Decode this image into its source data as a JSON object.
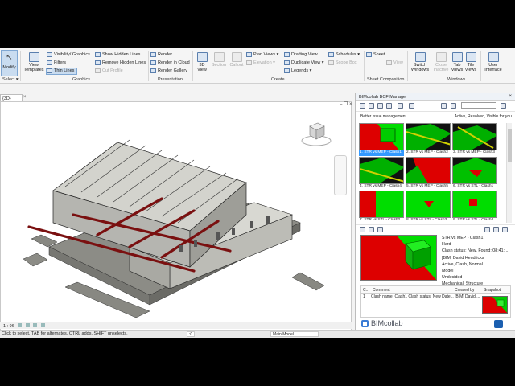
{
  "ribbon": {
    "modify": "Modify",
    "select": "Select ▾",
    "view_templates": "View Templates",
    "visibility": "Visibility/ Graphics",
    "filters": "Filters",
    "thin_lines": "Thin Lines",
    "show_hidden": "Show  Hidden Lines",
    "remove_hidden": "Remove  Hidden Lines",
    "cut_profile": "Cut  Profile",
    "render": "Render",
    "render_cloud": "Render  in Cloud",
    "render_gallery": "Render  Gallery",
    "view3d": "3D View",
    "section": "Section",
    "callout": "Callout",
    "plan_views": "Plan  Views ▾",
    "elevation": "Elevation ▾",
    "drafting_view": "Drafting  View",
    "duplicate_view": "Duplicate  View ▾",
    "legends": "Legends ▾",
    "schedules": "Schedules ▾",
    "scope_box": "Scope  Box",
    "sheet": "Sheet",
    "view_btn": "View",
    "switch_windows": "Switch Windows",
    "close_inactive": "Close Inactive",
    "tab_views": "Tab Views",
    "tile_views": "Tile Views",
    "user_interface": "User Interface",
    "groups": {
      "select": "Select",
      "graphics": "Graphics",
      "presentation": "Presentation",
      "create": "Create",
      "sheet_composition": "Sheet Composition",
      "windows": "Windows"
    }
  },
  "view": {
    "tab": "{3D}",
    "close": "×",
    "controls": "–  ❐  ×",
    "scale": "1 : 96"
  },
  "status": {
    "message": "Click to select, TAB for alternates, CTRL adds, SHIFT unselects.",
    "zero": ":0",
    "model": "Main Model"
  },
  "bcf": {
    "title": "BIMcollab BCF Manager",
    "close": "×",
    "subtitle": "Better issue management",
    "filter": "Active, Resolved, Visible for you",
    "issues": [
      {
        "label": "1. STR vs MEP - Clash1",
        "selected": true
      },
      {
        "label": "2. STR vs MEP - Clash2",
        "selected": false
      },
      {
        "label": "3. STR vs MEP - Clash3",
        "selected": false
      },
      {
        "label": "4. STR vs MEP - Clash4",
        "selected": false
      },
      {
        "label": "5. STR vs MEP - Clash5",
        "selected": false
      },
      {
        "label": "6. STR vs STL - Clash1",
        "selected": false
      },
      {
        "label": "7. STR vs STL - Clash2",
        "selected": false
      },
      {
        "label": "8. STR vs STL - Clash3",
        "selected": false
      },
      {
        "label": "9. STR vs STL - Clash4",
        "selected": false
      }
    ],
    "detail": {
      "title": "STR vs MEP - Clash1",
      "priority": "Hard",
      "status_line": "Clash  status:  New.  Found: 08:41: ...",
      "author": "[BIM] David Hendricks",
      "state": "Active, Clash, Normal",
      "type": "Model",
      "milestone": "Undecided",
      "area": "Mechanical, Structure"
    },
    "comments": {
      "col_c": "C..",
      "col_comment": "Comment",
      "col_created": "Created by",
      "col_snapshot": "Snapshot",
      "num": "1",
      "text": "Clash name: Clash1 Clash status: New Date...",
      "by": "[BIM] David ..."
    },
    "logo": "BIMcollab"
  }
}
